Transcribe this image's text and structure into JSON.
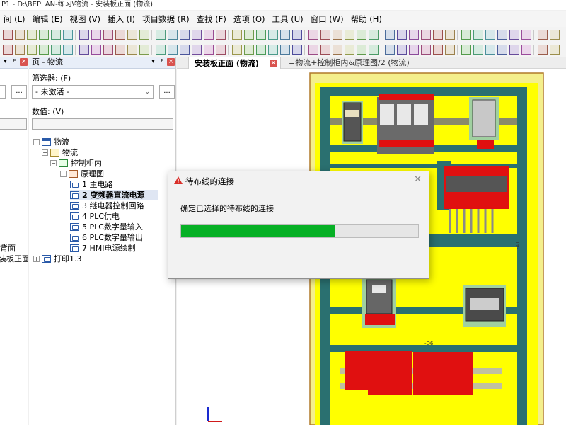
{
  "window": {
    "title": "P1 - D:\\BEPLAN-练习\\物流 - 安装板正面 (物流)"
  },
  "menu": [
    {
      "key": "edit_partial",
      "label": "间 (L)"
    },
    {
      "key": "edit",
      "label": "编辑 (E)"
    },
    {
      "key": "view",
      "label": "视图 (V)"
    },
    {
      "key": "insert",
      "label": "插入 (I)"
    },
    {
      "key": "project_data",
      "label": "项目数据 (R)"
    },
    {
      "key": "find",
      "label": "查找 (F)"
    },
    {
      "key": "options",
      "label": "选项 (O)"
    },
    {
      "key": "tools",
      "label": "工具 (U)"
    },
    {
      "key": "window",
      "label": "窗口 (W)"
    },
    {
      "key": "help",
      "label": "帮助 (H)"
    }
  ],
  "left_panel": {
    "tree_items": [
      "背面",
      "装板正面"
    ]
  },
  "page_panel": {
    "header": "页 - 物流",
    "filter_label": "筛选器: (F)",
    "filter_value": "- 未激活 -",
    "filter_more": "...",
    "value_label": "数值: (V)",
    "tree": [
      {
        "label": "物流",
        "icon": "project-icon",
        "expander": "minus"
      },
      {
        "label": "物流",
        "icon": "list-icon",
        "expander": "minus"
      },
      {
        "label": "控制柜内",
        "icon": "cabinet-icon",
        "expander": "minus"
      },
      {
        "label": "原理图",
        "icon": "schematic-icon",
        "expander": "minus"
      },
      {
        "label": "1 主电路",
        "icon": "page-icon"
      },
      {
        "label": "2 变频器直流电源",
        "icon": "page-icon",
        "selected": true
      },
      {
        "label": "3 继电器控制回路",
        "icon": "page-icon"
      },
      {
        "label": "4 PLC供电",
        "icon": "page-icon"
      },
      {
        "label": "5 PLC数字量输入",
        "icon": "page-icon"
      },
      {
        "label": "6 PLC数字量输出",
        "icon": "page-icon"
      },
      {
        "label": "7 HMI电源绘制",
        "icon": "page-icon"
      },
      {
        "label": "打印1.3",
        "icon": "page-icon",
        "expander": "plus"
      }
    ]
  },
  "tabs": [
    {
      "label": "安装板正面 (物流)",
      "active": true
    },
    {
      "label": "=物流+控制柜内&原理图/2 (物流)",
      "active": false
    }
  ],
  "canvas": {
    "label_a1": "-A1",
    "label_d6": "-D6"
  },
  "dialog": {
    "title": "待布线的连接",
    "message": "确定已选择的待布线的连接",
    "progress": 0.65,
    "colors": {
      "progress": "#06b025",
      "warning": "#d9302a"
    }
  }
}
